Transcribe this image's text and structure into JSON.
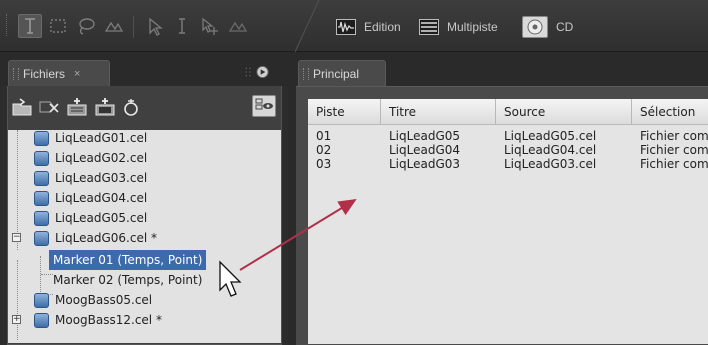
{
  "toolbar": {
    "workspaces": [
      {
        "label": "Edition",
        "icon": "edit-waveform-icon"
      },
      {
        "label": "Multipiste",
        "icon": "multitrack-icon"
      },
      {
        "label": "CD",
        "icon": "cd-icon"
      }
    ]
  },
  "left_panel": {
    "tab_label": "Fichiers",
    "tab_close": "×",
    "tree": {
      "items": [
        {
          "label": "LiqLeadG01.cel",
          "kind": "file"
        },
        {
          "label": "LiqLeadG02.cel",
          "kind": "file"
        },
        {
          "label": "LiqLeadG03.cel",
          "kind": "file"
        },
        {
          "label": "LiqLeadG04.cel",
          "kind": "file"
        },
        {
          "label": "LiqLeadG05.cel",
          "kind": "file"
        },
        {
          "label": "LiqLeadG06.cel *",
          "kind": "file-expanded"
        },
        {
          "label": "Marker 01 (Temps, Point)",
          "kind": "marker-selected"
        },
        {
          "label": "Marker 02 (Temps, Point)",
          "kind": "marker"
        },
        {
          "label": "MoogBass05.cel",
          "kind": "file"
        },
        {
          "label": "MoogBass12.cel *",
          "kind": "file-collapsed"
        }
      ],
      "expand_glyph": "−",
      "collapse_glyph": "+"
    }
  },
  "right_panel": {
    "tab_label": "Principal",
    "columns": [
      "Piste",
      "Titre",
      "Source",
      "Sélection"
    ],
    "rows": [
      {
        "piste": "01",
        "titre": "LiqLeadG05",
        "source": "LiqLeadG05.cel",
        "selection": "Fichier complet"
      },
      {
        "piste": "02",
        "titre": "LiqLeadG04",
        "source": "LiqLeadG04.cel",
        "selection": "Fichier complet"
      },
      {
        "piste": "03",
        "titre": "LiqLeadG03",
        "source": "LiqLeadG03.cel",
        "selection": "Fichier complet"
      }
    ]
  },
  "colors": {
    "selection": "#3d6aab",
    "annotation_arrow": "#b0304a",
    "panel_bg": "#2c2c2c"
  }
}
